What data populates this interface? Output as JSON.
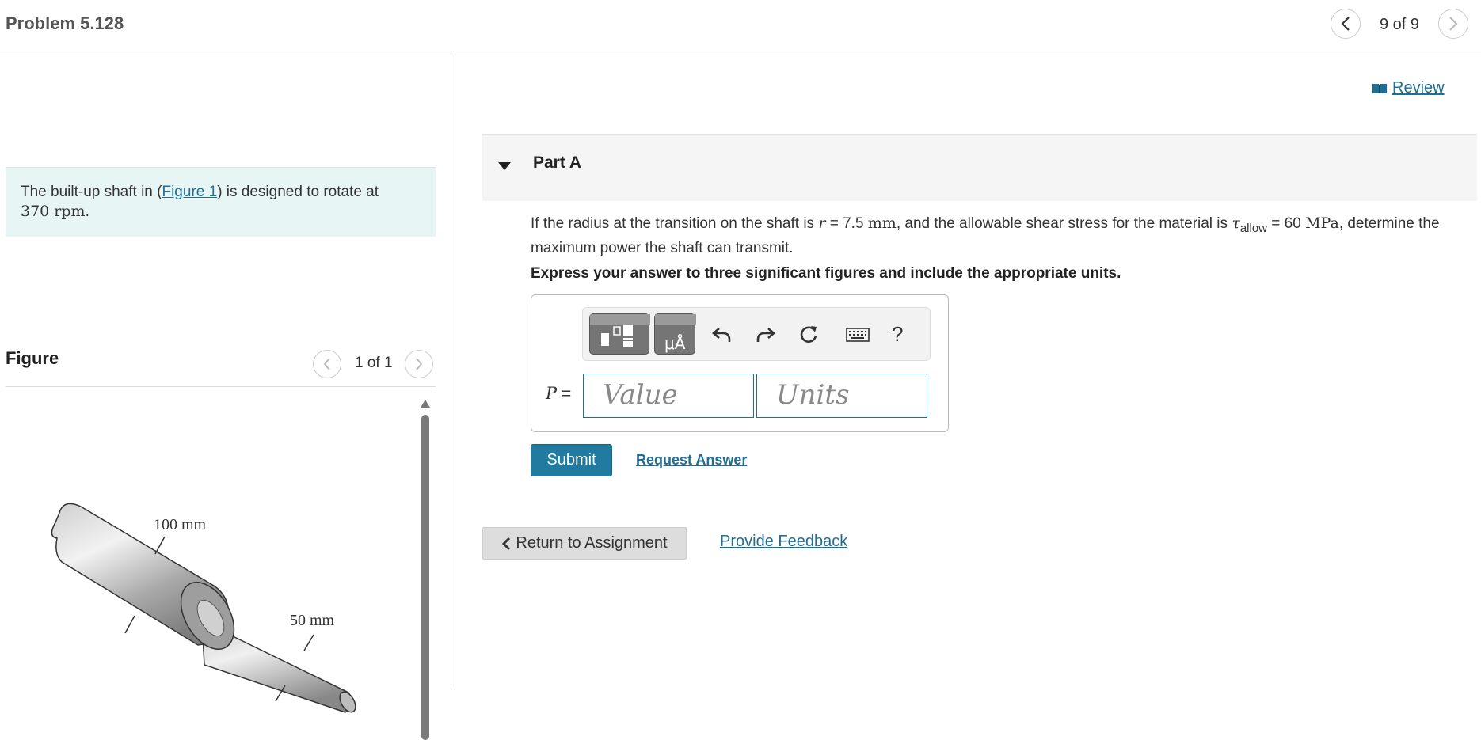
{
  "header": {
    "problem_title": "Problem 5.128",
    "page_count": "9 of 9"
  },
  "left": {
    "intro_prefix": "The built-up shaft in (",
    "figure_link": "Figure 1",
    "intro_suffix": ") is designed to rotate at",
    "speed_value": "370 rpm",
    "speed_end": ".",
    "figure_header": "Figure",
    "figure_count": "1 of 1",
    "figure_labels": {
      "large_dia": "100 mm",
      "small_dia": "50 mm"
    }
  },
  "right": {
    "review_label": "Review",
    "part_title": "Part A",
    "question": {
      "t1": "If the radius at the transition on the shaft is ",
      "r_sym": "r",
      "t2": " = 7.5 ",
      "mm": "mm",
      "t3": ", and the allowable shear stress for the material is ",
      "tau": "τ",
      "tau_sub": "allow",
      "t4": " = 60 ",
      "mpa": "MPa",
      "t5": ", determine the maximum power the shaft can transmit."
    },
    "instruction": "Express your answer to three significant figures and include the appropriate units.",
    "answer": {
      "variable": "P",
      "equals": "=",
      "value_placeholder": "Value",
      "units_placeholder": "Units",
      "help_symbol": "?",
      "units_btn_glyph": "μÅ"
    },
    "submit_label": "Submit",
    "request_answer_label": "Request Answer",
    "return_label": "Return to Assignment",
    "feedback_label": "Provide Feedback"
  }
}
